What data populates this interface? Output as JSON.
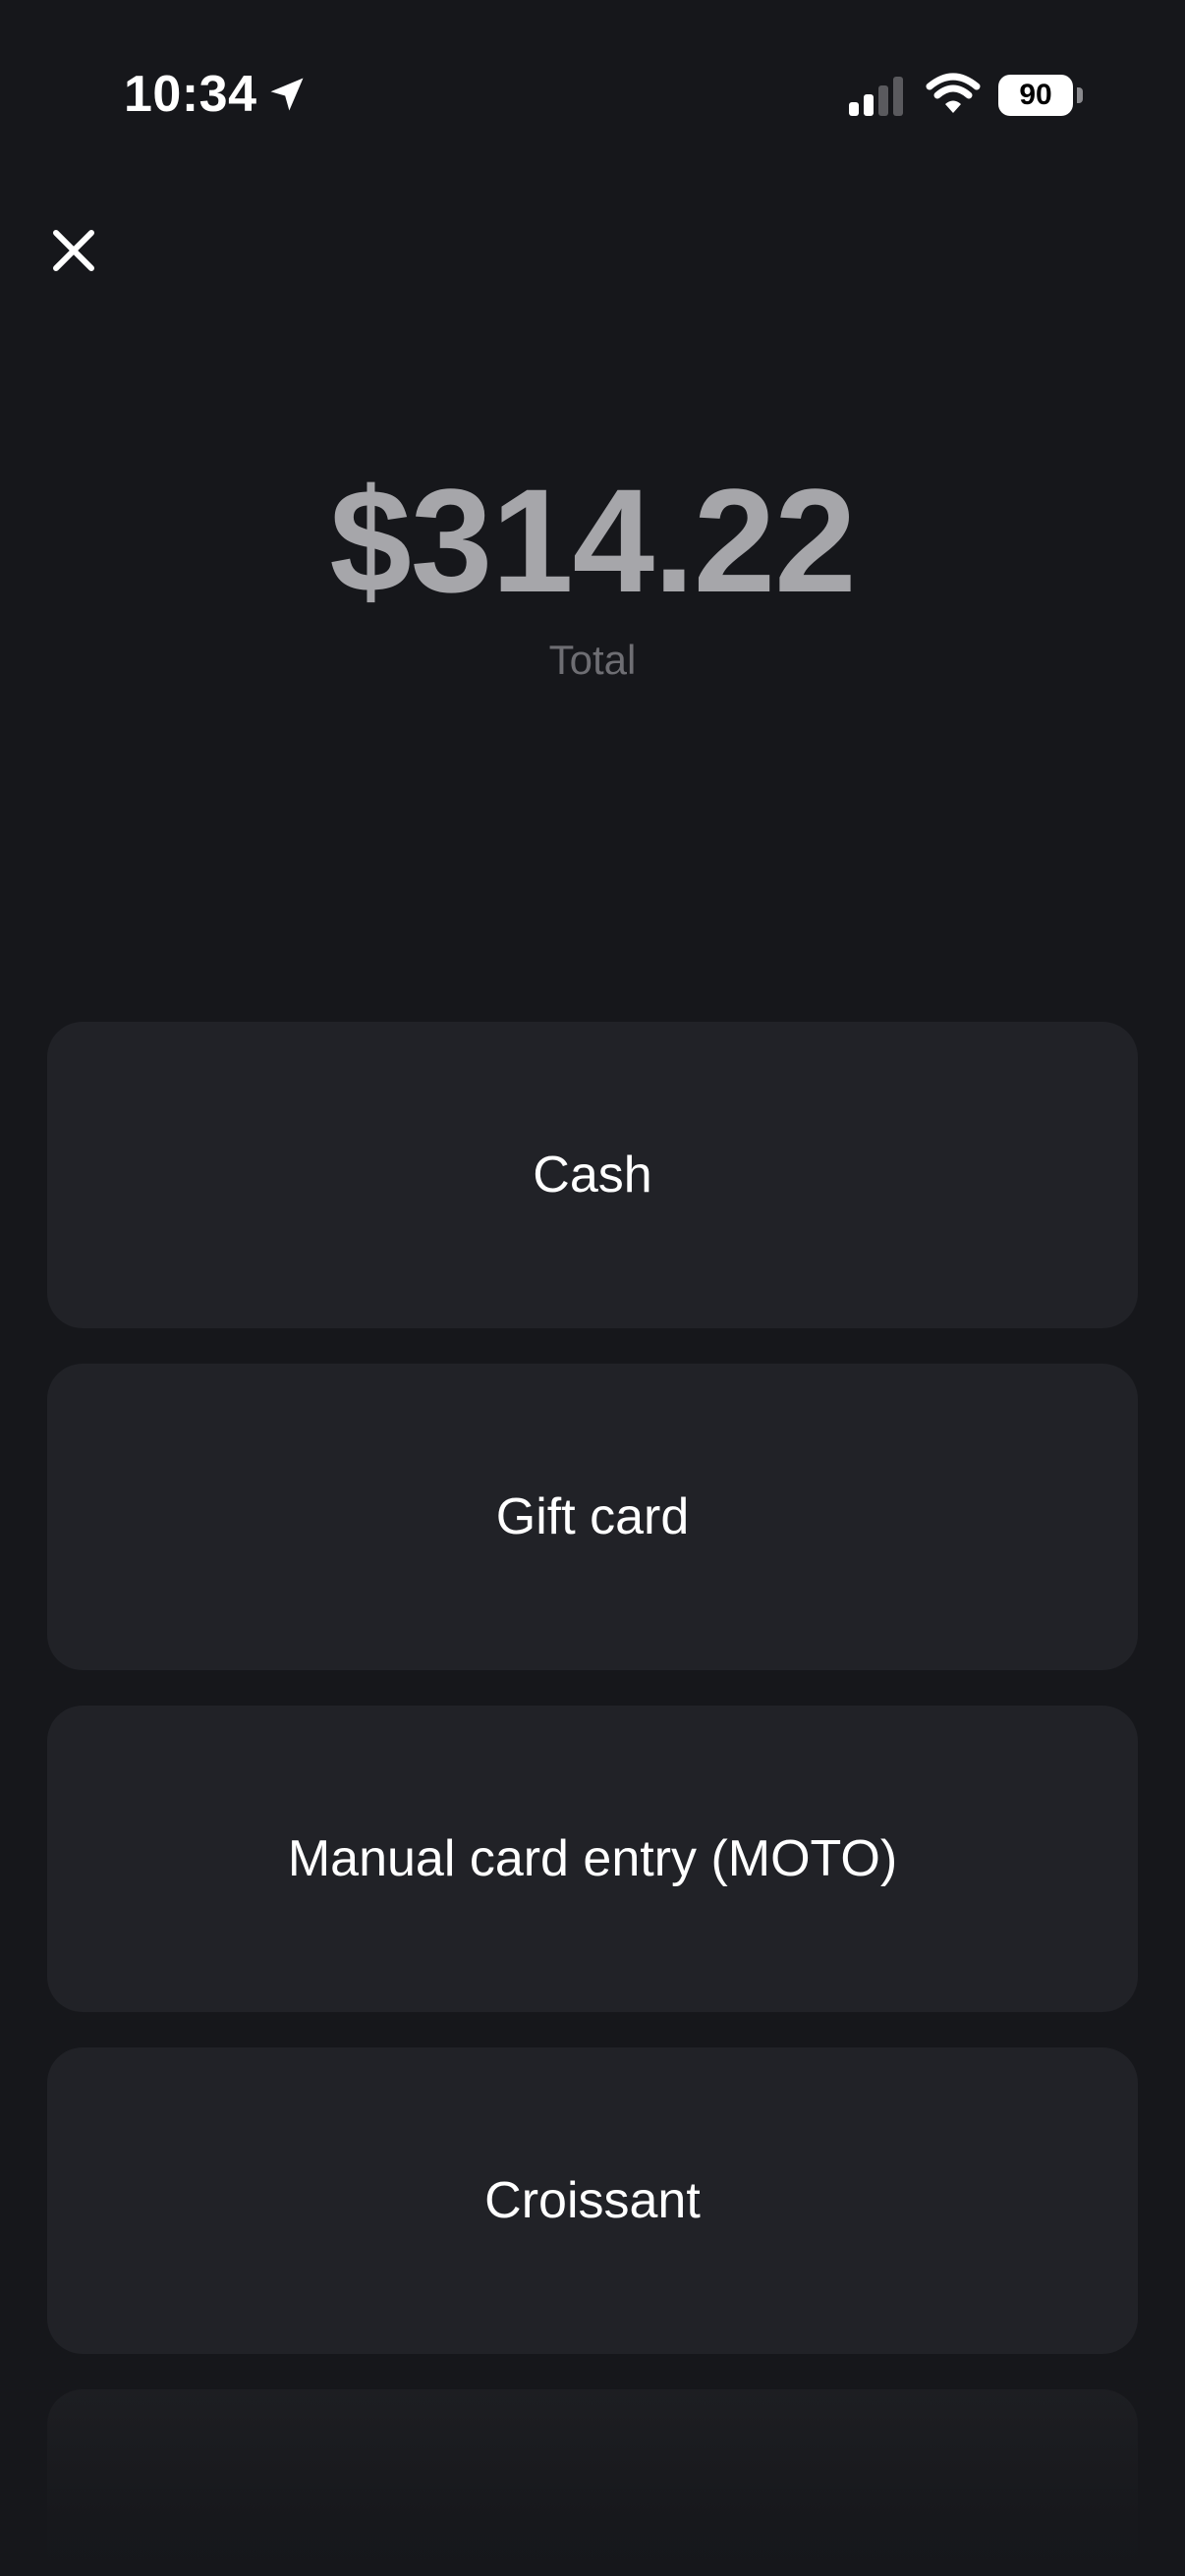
{
  "status_bar": {
    "time": "10:34",
    "battery_level": "90",
    "icons": [
      "location-arrow-icon",
      "cellular-signal-icon",
      "wifi-icon",
      "battery-icon"
    ]
  },
  "header": {
    "close_icon": "close-icon"
  },
  "summary": {
    "amount": "$314.22",
    "label": "Total"
  },
  "payment_options": [
    {
      "label": "Cash"
    },
    {
      "label": "Gift card"
    },
    {
      "label": "Manual card entry (MOTO)"
    },
    {
      "label": "Croissant"
    }
  ],
  "colors": {
    "background": "#16171b",
    "card": "#212227",
    "amount_text": "#a6a6aa",
    "secondary_text": "#6e6e73"
  }
}
